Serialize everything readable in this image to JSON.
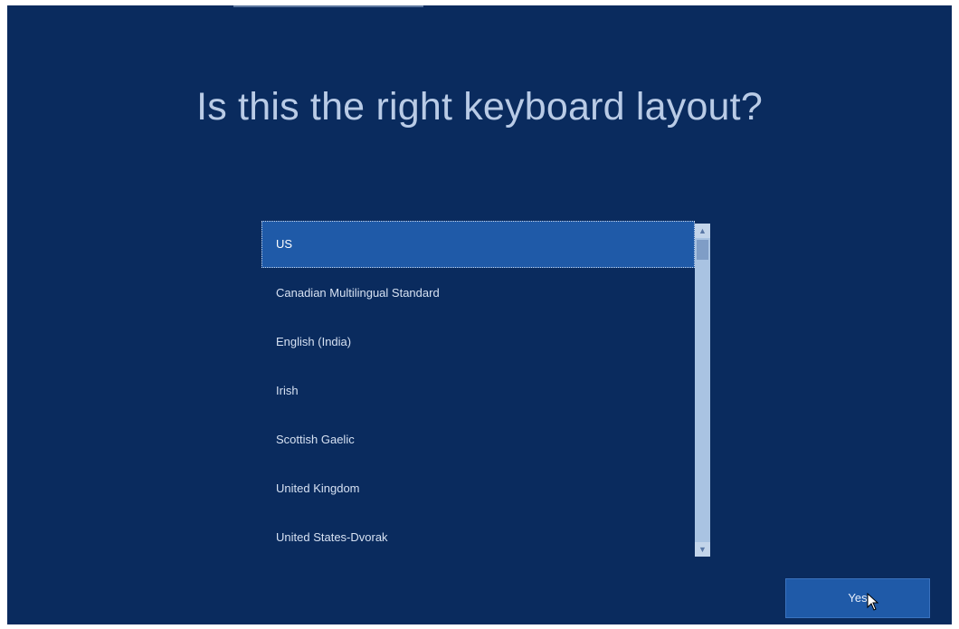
{
  "header": {
    "title": "Is this the right keyboard layout?"
  },
  "layout_list": {
    "items": [
      {
        "label": "US",
        "selected": true
      },
      {
        "label": "Canadian Multilingual Standard",
        "selected": false
      },
      {
        "label": "English (India)",
        "selected": false
      },
      {
        "label": "Irish",
        "selected": false
      },
      {
        "label": "Scottish Gaelic",
        "selected": false
      },
      {
        "label": "United Kingdom",
        "selected": false
      },
      {
        "label": "United States-Dvorak",
        "selected": false
      }
    ]
  },
  "scrollbar": {
    "up_icon": "chevron-up-icon",
    "down_icon": "chevron-down-icon"
  },
  "footer": {
    "yes_label": "Yes"
  },
  "colors": {
    "background": "#0a2b5e",
    "accent": "#1f5aa8",
    "title_text": "#b9cbe6"
  }
}
